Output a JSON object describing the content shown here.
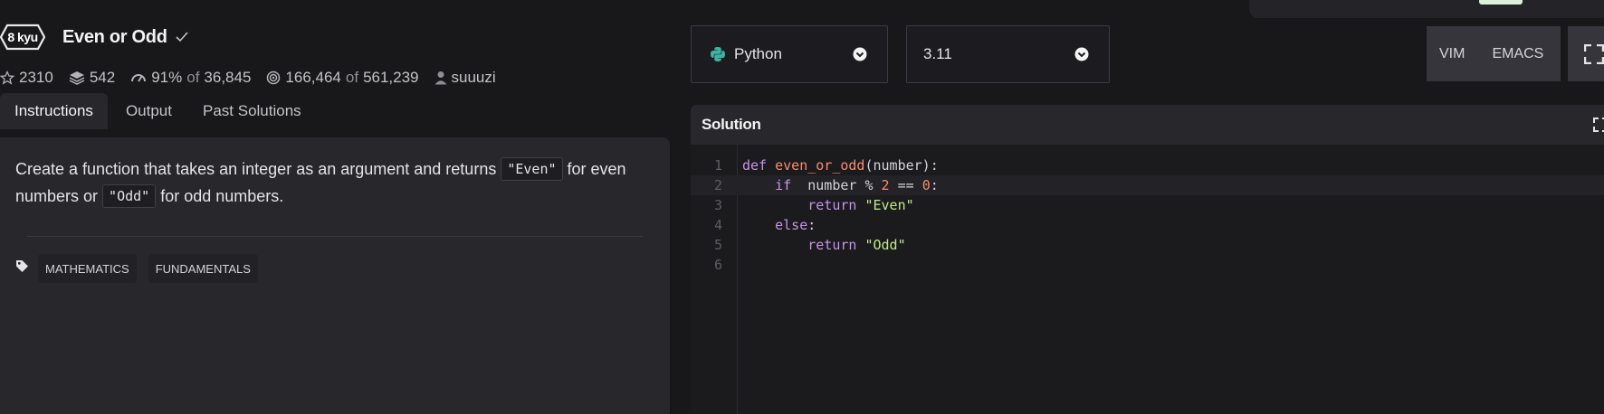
{
  "kata": {
    "rank": "8 kyu",
    "title": "Even or Odd",
    "stars": "2310",
    "collections": "542",
    "satisfaction_pct": "91%",
    "satisfaction_of_label": "of",
    "satisfaction_total": "36,845",
    "completed": "166,464",
    "completed_of_label": "of",
    "completed_total": "561,239",
    "author": "suuuzi"
  },
  "tabs": [
    "Instructions",
    "Output",
    "Past Solutions"
  ],
  "instructions": {
    "part1": "Create a function that takes an integer as an argument and returns ",
    "code1": "\"Even\"",
    "part2": " for even numbers or ",
    "code2": "\"Odd\"",
    "part3": " for odd numbers."
  },
  "tags": [
    "MATHEMATICS",
    "FUNDAMENTALS"
  ],
  "editor_controls": {
    "language": "Python",
    "version": "3.11",
    "modes": [
      "VIM",
      "EMACS"
    ]
  },
  "solution": {
    "title": "Solution",
    "line_numbers": [
      "1",
      "2",
      "3",
      "4",
      "5",
      "6"
    ],
    "lines": [
      "def even_or_odd(number):",
      "    if  number % 2 == 0:",
      "        return \"Even\"",
      "    else:",
      "        return \"Odd\"",
      ""
    ]
  },
  "colors": {
    "background": "#18181b",
    "panel": "#27272c",
    "accent_green": "#c3e88d",
    "keyword": "#c792ea"
  },
  "icons": [
    "star-icon",
    "collections-icon",
    "satisfaction-icon",
    "completed-icon",
    "user-icon",
    "tag-icon",
    "python-icon",
    "chevron-down-icon",
    "fullscreen-icon",
    "expand-icon",
    "check-icon"
  ]
}
